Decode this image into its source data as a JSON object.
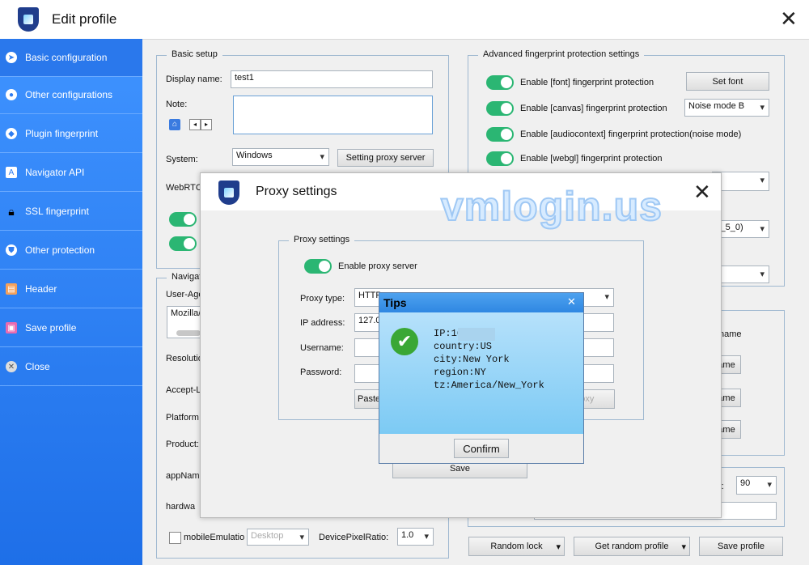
{
  "window": {
    "title": "Edit profile"
  },
  "sidebar": {
    "items": [
      {
        "label": "Basic configuration",
        "icon": "compass-icon"
      },
      {
        "label": "Other configurations",
        "icon": "chrome-icon"
      },
      {
        "label": "Plugin fingerprint",
        "icon": "plugin-icon"
      },
      {
        "label": "Navigator API",
        "icon": "api-icon"
      },
      {
        "label": "SSL fingerprint",
        "icon": "lock-icon"
      },
      {
        "label": "Other protection",
        "icon": "shield-icon"
      },
      {
        "label": "Header",
        "icon": "header-icon"
      },
      {
        "label": "Save profile",
        "icon": "save-icon"
      },
      {
        "label": "Close",
        "icon": "close-icon"
      }
    ]
  },
  "basic": {
    "legend": "Basic setup",
    "display_name_label": "Display name:",
    "display_name_value": "test1",
    "note_label": "Note:",
    "system_label": "System:",
    "system_value": "Windows",
    "proxy_button": "Setting proxy server",
    "webrtc_label": "WebRTC"
  },
  "nav": {
    "legend": "Navigat",
    "useragent_label": "User-Age",
    "useragent_value": "Mozilla/",
    "resolution_label": "Resolutio",
    "accept_label": "Accept-L",
    "platform_label": "Platform",
    "product_label": "Product:",
    "appname_label": "appName",
    "hardware_label": "hardwa",
    "mobile_label": "mobileEmulatio",
    "mobile_value": "Desktop",
    "dpr_label": "DevicePixelRatio:",
    "dpr_value": "1.0"
  },
  "advanced": {
    "legend": "Advanced fingerprint protection settings",
    "font_label": "Enable [font] fingerprint protection",
    "set_font_button": "Set font",
    "canvas_label": "Enable [canvas] fingerprint protection",
    "canvas_mode": "Noise mode B",
    "audio_label": "Enable [audiocontext] fingerprint  protection(noise mode)",
    "webgl_label": "Enable [webgl] fingerprint protection",
    "partial_combo": "s_5_0)",
    "name_partial": "name",
    "ame_button": "ame",
    "r_label": "r:",
    "r_value": "90"
  },
  "footer": {
    "random_lock": "Random lock",
    "get_random_profile": "Get random profile",
    "save_profile": "Save profile"
  },
  "proxy_dialog": {
    "title": "Proxy settings",
    "legend": "Proxy settings",
    "enable_label": "Enable proxy server",
    "type_label": "Proxy type:",
    "type_value": "HTTP",
    "ip_label": "IP address:",
    "ip_value": "127.0",
    "username_label": "Username:",
    "password_label": "Password:",
    "paste_button": "Paste",
    "check_partial": "roxy",
    "save_button": "Save"
  },
  "watermark": "vmlogin.us",
  "tips": {
    "title": "Tips",
    "ip": "IP:16          102",
    "country": "country:US",
    "city": "city:New York",
    "region": "region:NY",
    "tz": "tz:America/New_York",
    "confirm": "Confirm"
  },
  "colors": {
    "sidebar": "#2f7df0",
    "toggle_on": "#2bb673",
    "tips_header": "#3a93e8"
  }
}
